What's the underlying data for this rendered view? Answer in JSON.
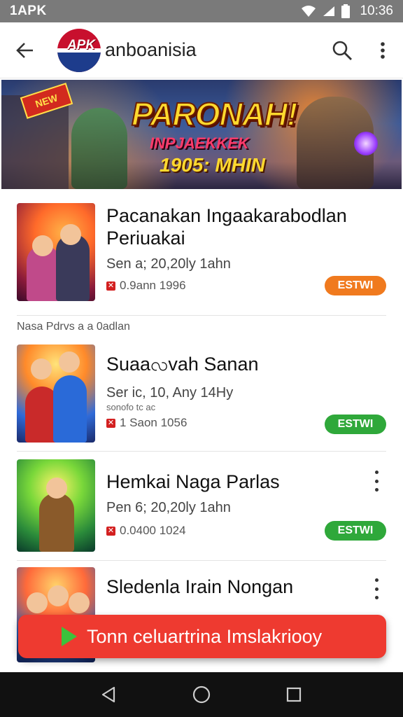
{
  "status_bar": {
    "carrier": "1APK",
    "time": "10:36",
    "icons": [
      "wifi-icon",
      "signal-icon",
      "battery-icon"
    ]
  },
  "app_bar": {
    "logo_text": "APK",
    "title": "anboanisia",
    "icons": [
      "back-arrow-icon",
      "search-icon",
      "more-vert-icon"
    ]
  },
  "banner": {
    "ribbon": "NEW",
    "title": "PARONAH!",
    "subtitle": "INPJAEKKEK",
    "subtitle2": "1905: MHIN"
  },
  "items": [
    {
      "title": "Pacanakan Ingaakarabodlan Periuakai",
      "meta": "Sen a; 20,20ly 1ahn",
      "meta_small": "",
      "stat": "0.9ann 1996",
      "button": "ESTWI",
      "button_color": "#f07a1e",
      "has_more": false
    },
    {
      "title": "Suaaလvah Sanan",
      "meta": "Ser ic, 10, Any 14Hy",
      "meta_small": "sonofo tc ac",
      "stat": "1 Saon 1056",
      "button": "ESTWI",
      "button_color": "#2fa83a",
      "has_more": false
    },
    {
      "title": "Hemkai Naga Parlas",
      "meta": "Pen 6; 20,20ly 1ahn",
      "meta_small": "",
      "stat": "0.0400 1024",
      "button": "ESTWI",
      "button_color": "#2fa83a",
      "has_more": true
    },
    {
      "title": "Sledenla Irain Nongan",
      "meta": "",
      "meta_small": "",
      "stat": "",
      "button": "",
      "button_color": "#2fa83a",
      "has_more": true
    }
  ],
  "section_label": "Nasa Pdrvs a a 0adlan",
  "cta": {
    "label": "Tonn celuartrina Imslakriooy",
    "play_color": "#3cc23c",
    "bg_color": "#ee3a30"
  },
  "nav_bar": {
    "icons": [
      "nav-back-icon",
      "nav-home-icon",
      "nav-recents-icon"
    ]
  }
}
